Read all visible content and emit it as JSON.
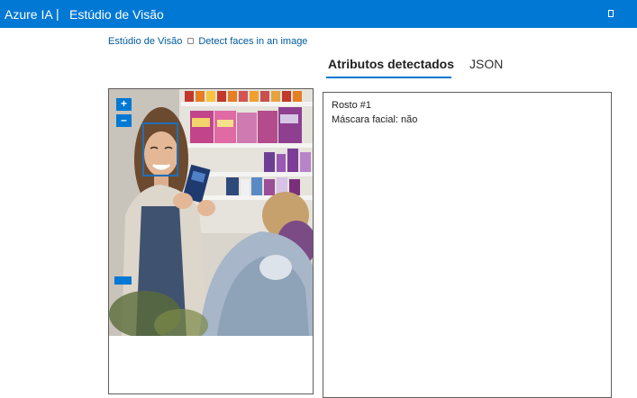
{
  "topbar": {
    "brand": "Azure IA",
    "separator": "|",
    "studio": "Estúdio de Visão"
  },
  "breadcrumb": {
    "home": "Estúdio de Visão",
    "current": "Detect faces in an image"
  },
  "tabs": [
    {
      "label": "Atributos detectados",
      "active": true
    },
    {
      "label": "JSON",
      "active": false
    }
  ],
  "viewer": {
    "zoom_in": "+",
    "zoom_out": "–"
  },
  "results": {
    "face_title": "Rosto #1",
    "mask_label": "Máscara facial: não"
  },
  "colors": {
    "accent": "#0078d4",
    "face_box": "#1f6fb8"
  }
}
